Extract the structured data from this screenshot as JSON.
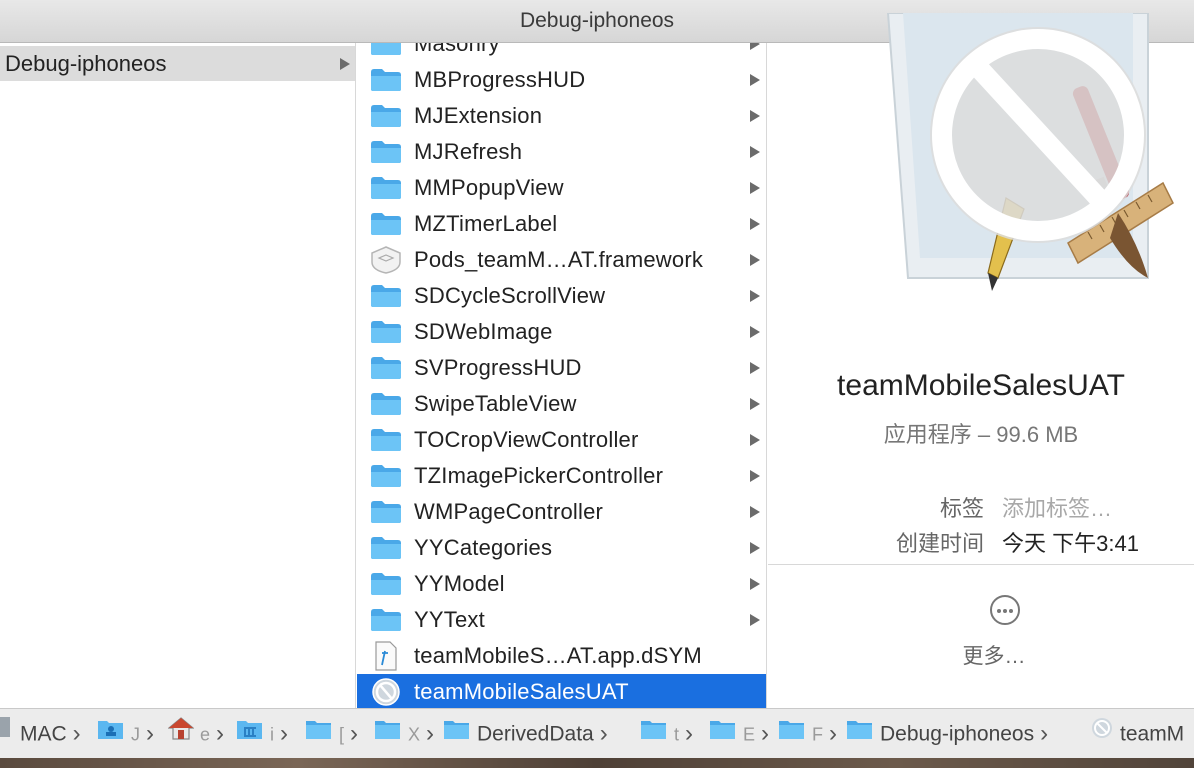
{
  "window": {
    "title": "Debug-iphoneos"
  },
  "column1": {
    "selected_item": "Debug-iphoneos"
  },
  "column2": {
    "items": [
      {
        "label": "Masonry",
        "kind": "folder",
        "has_children": true
      },
      {
        "label": "MBProgressHUD",
        "kind": "folder",
        "has_children": true
      },
      {
        "label": "MJExtension",
        "kind": "folder",
        "has_children": true
      },
      {
        "label": "MJRefresh",
        "kind": "folder",
        "has_children": true
      },
      {
        "label": "MMPopupView",
        "kind": "folder",
        "has_children": true
      },
      {
        "label": "MZTimerLabel",
        "kind": "folder",
        "has_children": true
      },
      {
        "label": "Pods_teamM…AT.framework",
        "kind": "framework",
        "has_children": true
      },
      {
        "label": "SDCycleScrollView",
        "kind": "folder",
        "has_children": true
      },
      {
        "label": "SDWebImage",
        "kind": "folder",
        "has_children": true
      },
      {
        "label": "SVProgressHUD",
        "kind": "folder",
        "has_children": true
      },
      {
        "label": "SwipeTableView",
        "kind": "folder",
        "has_children": true
      },
      {
        "label": "TOCropViewController",
        "kind": "folder",
        "has_children": true
      },
      {
        "label": "TZImagePickerController",
        "kind": "folder",
        "has_children": true
      },
      {
        "label": "WMPageController",
        "kind": "folder",
        "has_children": true
      },
      {
        "label": "YYCategories",
        "kind": "folder",
        "has_children": true
      },
      {
        "label": "YYModel",
        "kind": "folder",
        "has_children": true
      },
      {
        "label": "YYText",
        "kind": "folder",
        "has_children": true
      },
      {
        "label": "teamMobileS…AT.app.dSYM",
        "kind": "dsym",
        "has_children": false
      },
      {
        "label": "teamMobileSalesUAT",
        "kind": "app",
        "has_children": false,
        "selected": true
      }
    ]
  },
  "preview": {
    "name": "teamMobileSalesUAT",
    "kind_size": "应用程序 – 99.6 MB",
    "tags_key": "标签",
    "tags_placeholder": "添加标签…",
    "created_key": "创建时间",
    "created_value": "今天 下午3:41",
    "more_label": "更多…"
  },
  "pathbar": {
    "items": [
      {
        "label": "MAC",
        "icon": "drive-icon"
      },
      {
        "label": "J",
        "icon": "user-folder-icon"
      },
      {
        "label": "e",
        "icon": "home-icon"
      },
      {
        "label": "i",
        "icon": "library-icon"
      },
      {
        "label": "[",
        "icon": "folder-icon"
      },
      {
        "label": "X",
        "icon": "folder-icon"
      },
      {
        "label": "DerivedData",
        "icon": "folder-icon"
      },
      {
        "label": "t",
        "icon": "folder-icon"
      },
      {
        "label": "E",
        "icon": "folder-icon"
      },
      {
        "label": "F",
        "icon": "folder-icon"
      },
      {
        "label": "Debug-iphoneos",
        "icon": "folder-icon"
      },
      {
        "label": "teamM",
        "icon": "app-icon"
      }
    ]
  },
  "colors": {
    "selection": "#1a6fe0",
    "folder": "#5bb7f0",
    "sidebar_selection": "#dcdcdc"
  }
}
